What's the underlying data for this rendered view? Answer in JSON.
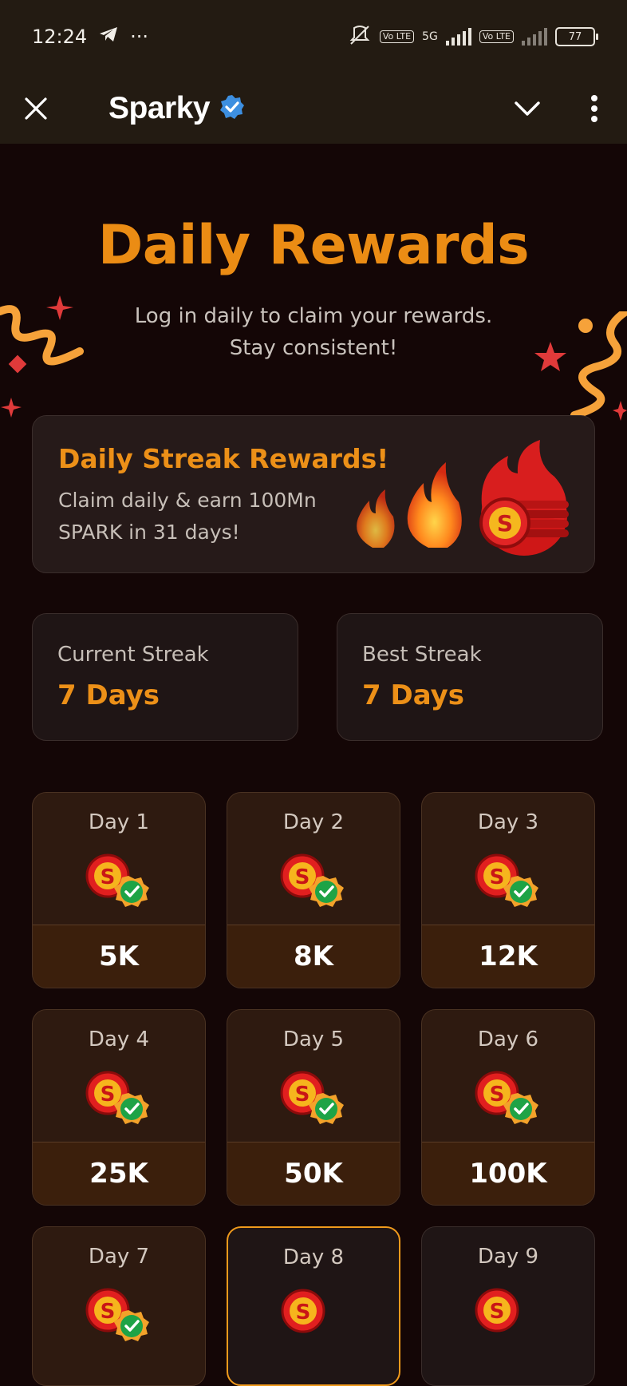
{
  "status_bar": {
    "time": "12:24",
    "more": "···",
    "battery": "77",
    "net_5g": "5G",
    "volte": "Vo LTE"
  },
  "app_bar": {
    "title": "Sparky"
  },
  "header": {
    "title": "Daily Rewards",
    "subtitle_line1": "Log in daily to claim your rewards.",
    "subtitle_line2": "Stay consistent!"
  },
  "streak_card": {
    "heading": "Daily Streak Rewards!",
    "text_line1": "Claim daily & earn 100Mn",
    "text_line2": "SPARK in 31 days!"
  },
  "stats": {
    "current": {
      "label": "Current Streak",
      "value": "7 Days"
    },
    "best": {
      "label": "Best Streak",
      "value": "7 Days"
    }
  },
  "days": [
    {
      "label": "Day 1",
      "reward": "5K",
      "claimed": true
    },
    {
      "label": "Day 2",
      "reward": "8K",
      "claimed": true
    },
    {
      "label": "Day 3",
      "reward": "12K",
      "claimed": true
    },
    {
      "label": "Day 4",
      "reward": "25K",
      "claimed": true
    },
    {
      "label": "Day 5",
      "reward": "50K",
      "claimed": true
    },
    {
      "label": "Day 6",
      "reward": "100K",
      "claimed": true
    },
    {
      "label": "Day 7",
      "reward": "",
      "claimed": true
    },
    {
      "label": "Day 8",
      "reward": "",
      "claimed": false,
      "current": true
    },
    {
      "label": "Day 9",
      "reward": "",
      "claimed": false
    }
  ],
  "colors": {
    "accent": "#eb8c14",
    "background": "#140606",
    "bar": "#231b12"
  }
}
